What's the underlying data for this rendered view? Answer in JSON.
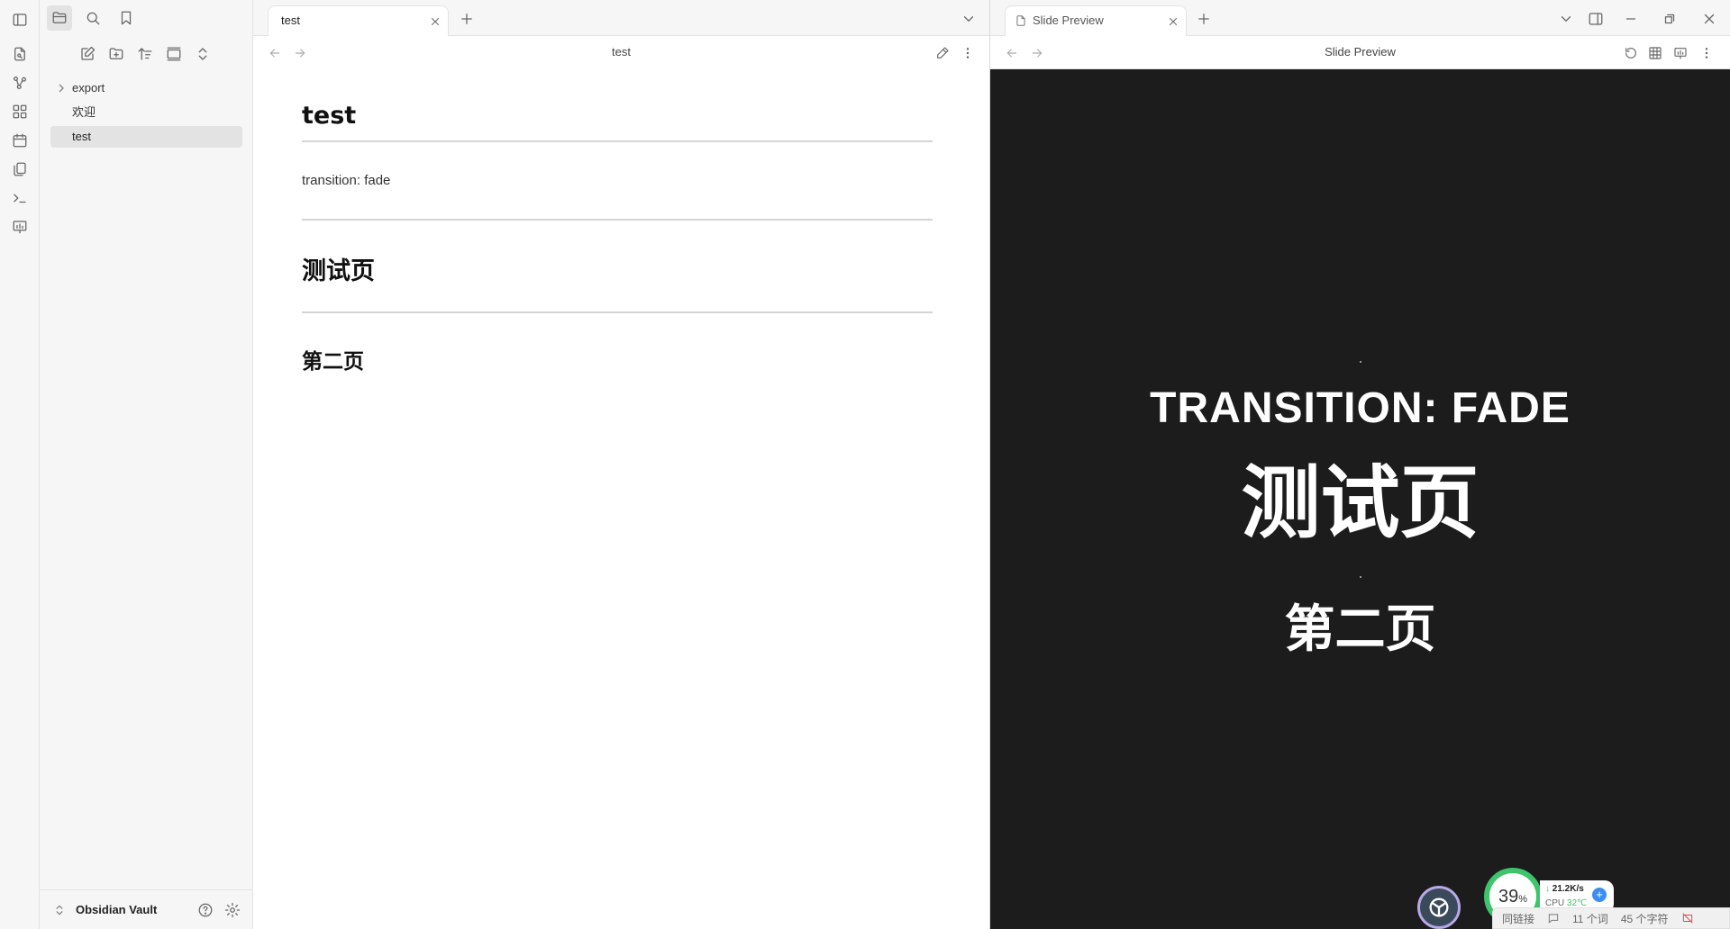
{
  "sidebar": {
    "tree": [
      {
        "label": "export",
        "type": "folder"
      },
      {
        "label": "欢迎",
        "type": "file"
      },
      {
        "label": "test",
        "type": "file",
        "active": true
      }
    ],
    "vault_name": "Obsidian Vault"
  },
  "main": {
    "tab_label": "test",
    "nav_title": "test",
    "doc": {
      "h1": "test",
      "para": "transition: fade",
      "h2": "测试页",
      "h3": "第二页"
    }
  },
  "preview": {
    "tab_label": "Slide Preview",
    "nav_title": "Slide Preview",
    "slide": {
      "line1": "TRANSITION: FADE",
      "line2": "测试页",
      "line3": "第二页"
    }
  },
  "status": {
    "sync_text": "同链接",
    "words": "11 个词",
    "chars": "45 个字符"
  },
  "widget": {
    "percent": "39",
    "percent_unit": "%",
    "net_speed": "21.2K/s",
    "cpu_label": "CPU",
    "cpu_temp": "32℃"
  },
  "colors": {
    "accent": "#7c3aed",
    "gauge_green": "#3ec46d",
    "slide_bg": "#1c1c1c"
  }
}
